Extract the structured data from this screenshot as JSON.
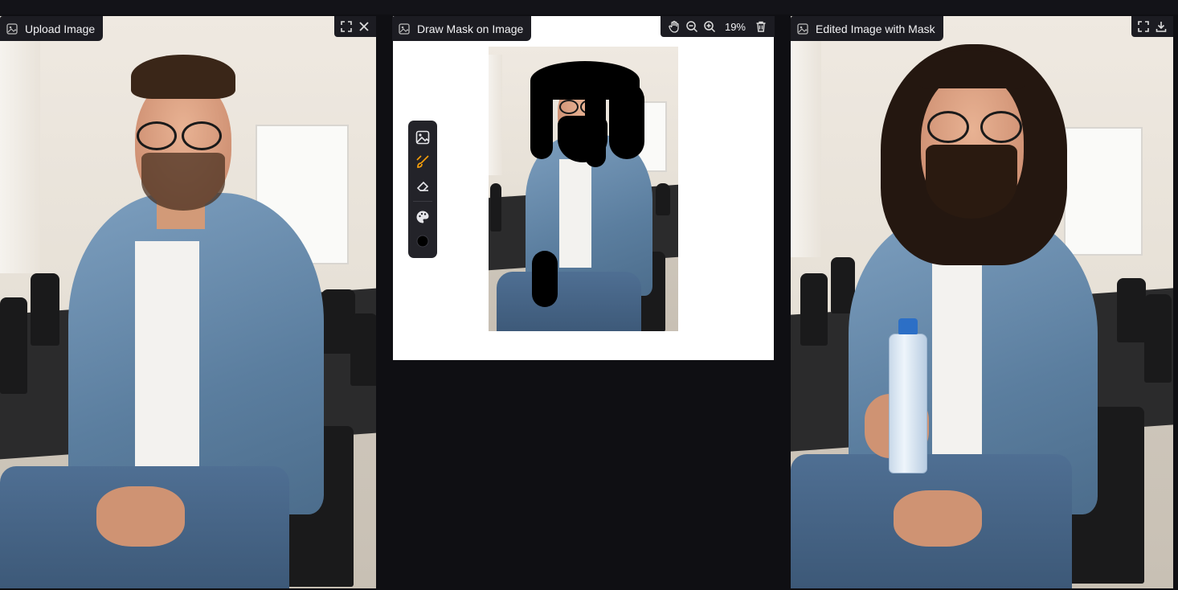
{
  "panels": {
    "upload": {
      "label": "Upload Image",
      "icons": [
        "image-icon",
        "fullscreen-icon",
        "close-icon"
      ]
    },
    "mask": {
      "label": "Draw Mask on Image",
      "zoom": "19%",
      "toolbar_icons": [
        "pan-hand-icon",
        "zoom-out-icon",
        "zoom-in-icon",
        "trash-icon"
      ],
      "side_tools": [
        "image-icon",
        "brush-icon",
        "eraser-icon",
        "palette-icon",
        "brush-size-icon"
      ],
      "active_tool": "brush-icon"
    },
    "result": {
      "label": "Edited Image with Mask",
      "icons": [
        "image-icon",
        "fullscreen-icon",
        "download-icon"
      ]
    }
  },
  "colors": {
    "background": "#0f0f13",
    "chip": "#1c1c22",
    "accent": "#f59e0b",
    "mask": "#000000"
  }
}
